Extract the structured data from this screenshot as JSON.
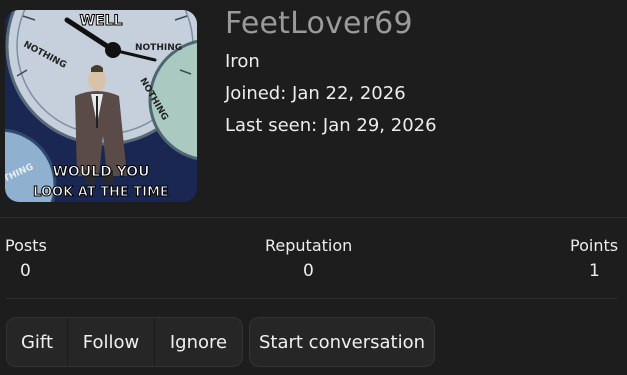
{
  "profile": {
    "username": "FeetLover69",
    "rank": "Iron",
    "joined": "Joined: Jan 22, 2026",
    "last_seen": "Last seen: Jan 29, 2026",
    "avatar": {
      "description_icon": "meme-avatar-icon",
      "text_top": "WELL",
      "text_bottom_1": "WOULD YOU",
      "text_bottom_2": "LOOK AT THE TIME",
      "clock_words": [
        "NOTHING",
        "NOTHING",
        "NOTHING",
        "THING"
      ]
    }
  },
  "stats": {
    "posts": {
      "label": "Posts",
      "value": "0"
    },
    "reputation": {
      "label": "Reputation",
      "value": "0"
    },
    "points": {
      "label": "Points",
      "value": "1"
    }
  },
  "actions": {
    "gift": "Gift",
    "follow": "Follow",
    "ignore": "Ignore",
    "start_conversation": "Start conversation"
  },
  "colors": {
    "background": "#1d1d1d",
    "username": "#9a9a9a",
    "button_bg": "#262626"
  }
}
